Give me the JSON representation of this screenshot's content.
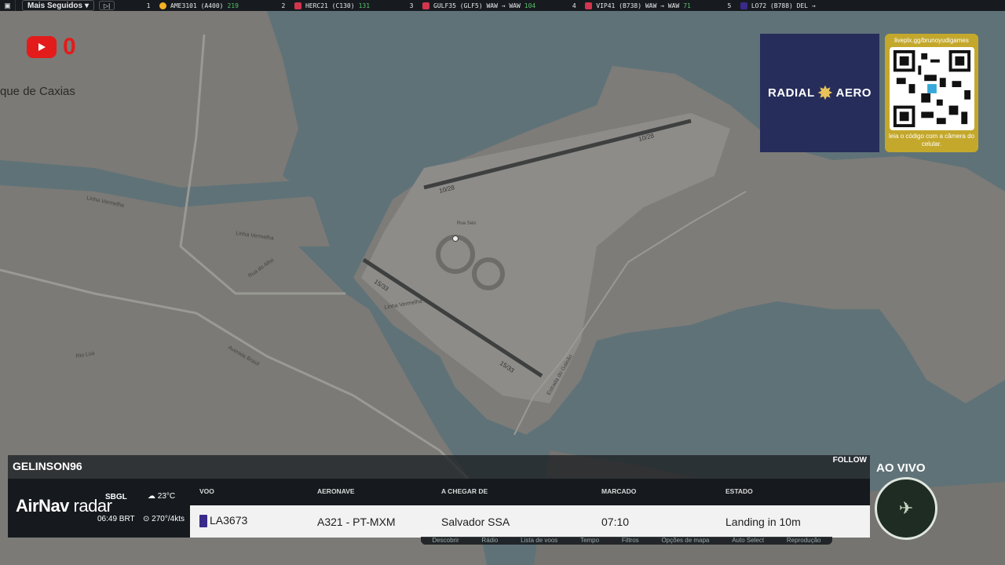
{
  "topbar": {
    "filter_label": "Mais Seguidos",
    "flights": [
      {
        "rank": "1",
        "callsign": "AME3101 (A400)",
        "count": "219",
        "color": "#f5b324"
      },
      {
        "rank": "2",
        "callsign": "HERC21 (C130)",
        "count": "131",
        "color": "#d3354e"
      },
      {
        "rank": "3",
        "callsign": "GULF35 (GLF5) WAW → WAW",
        "count": "104",
        "color": "#d3354e"
      },
      {
        "rank": "4",
        "callsign": "VIP41 (B738) WAW → WAW",
        "count": "71",
        "color": "#d3354e"
      },
      {
        "rank": "5",
        "callsign": "LO72 (B788) DEL →",
        "count": "",
        "color": "#3a2a8a"
      }
    ]
  },
  "youtube": {
    "count": "0"
  },
  "map": {
    "place": "que de Caxias",
    "labels": {
      "runway_1028a": "10/28",
      "runway_1028b": "10/28",
      "runway_1533a": "15/33",
      "runway_1533b": "15/33",
      "linha_vermelha_1": "Linha Vermelha",
      "linha_vermelha_2": "Linha Vermelha",
      "linha_vermelha_3": "Linha Vermelha",
      "avenida_brasil": "Avenida Brasil",
      "estrada_galeao": "Estrada do Galeão",
      "rua_abc": "Rua do Alho",
      "rio_lua": "Rio Lua",
      "rua_seis": "Rua Seis"
    },
    "colors": {
      "water": "#5f7278",
      "land": "#7d7c78",
      "airport": "#8f8f8d",
      "runway": "#3e3f3f"
    }
  },
  "sponsor": {
    "left_word": "RADIAL",
    "right_word": "AERO",
    "qr_url": "liveplx.gg/brunoyudigames",
    "qr_caption": "leia o código com a câmera do celular."
  },
  "panel": {
    "username": "GELINSON96",
    "follow": "FOLLOW",
    "brand_a": "AirNav",
    "brand_b": "radar",
    "airport": "SBGL",
    "time": "06:49 BRT",
    "temp": "23°C",
    "wind": "270°/4kts",
    "headers": {
      "flight": "VOO",
      "aircraft": "AERONAVE",
      "origin": "A CHEGAR DE",
      "scheduled": "MARCADO",
      "status": "ESTADO"
    },
    "row": {
      "flight": "LA3673",
      "aircraft": "A321 - PT-MXM",
      "origin": "Salvador SSA",
      "scheduled": "07:10",
      "status": "Landing in 10m"
    },
    "menu": [
      "Descobrir",
      "Rádio",
      "Lista de voos",
      "Tempo",
      "Filtros",
      "Opções de mapa",
      "Auto Select",
      "Reprodução"
    ]
  },
  "live": {
    "label": "AO VIVO"
  }
}
